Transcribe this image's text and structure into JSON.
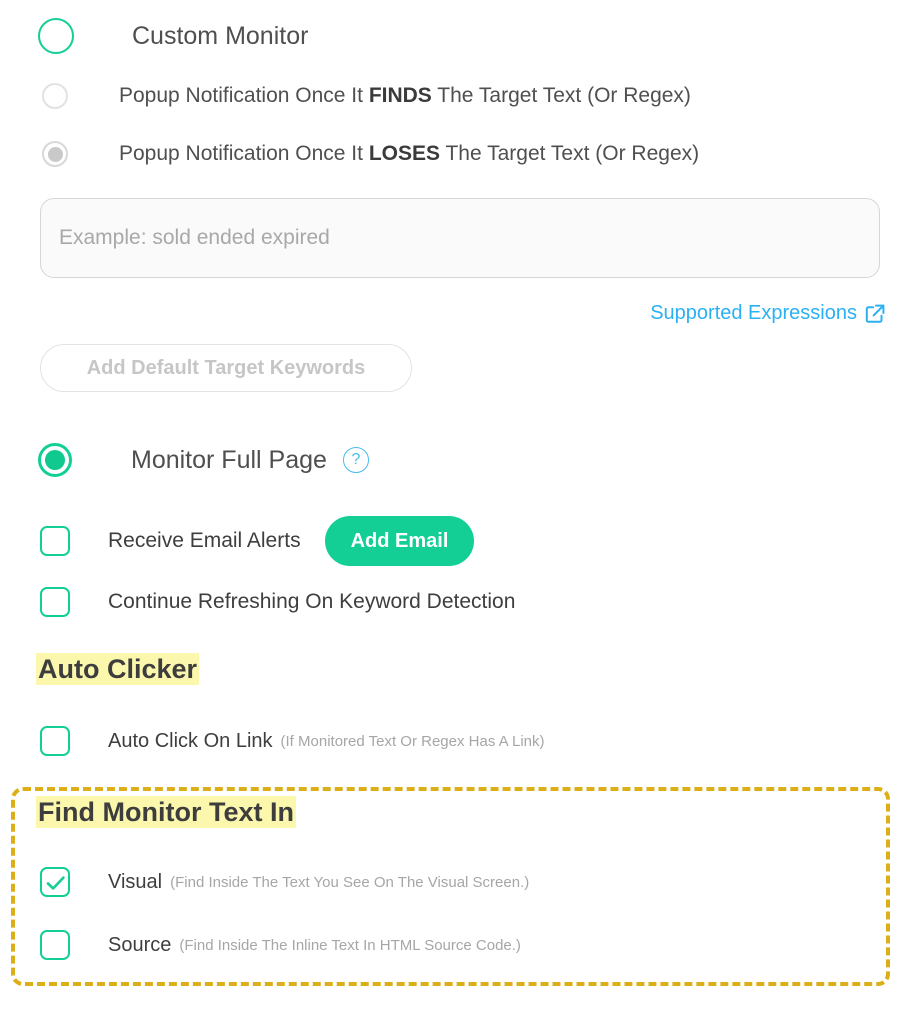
{
  "monitor_options": {
    "custom_monitor": {
      "label": "Custom Monitor",
      "state": "unselected"
    },
    "finds": {
      "prefix": "Popup Notification Once It ",
      "strong": "FINDS",
      "suffix": " The Target Text (Or Regex)",
      "state": "unselected"
    },
    "loses": {
      "prefix": "Popup Notification Once It ",
      "strong": "LOSES",
      "suffix": " The Target Text (Or Regex)",
      "state": "selected-disabled"
    }
  },
  "keywords_input": {
    "value": "",
    "placeholder": "Example: sold ended expired"
  },
  "supported_expressions": {
    "label": "Supported Expressions",
    "icon": "external-link-icon",
    "color": "#2ab1f2"
  },
  "add_default_keywords_button": {
    "label": "Add Default Target Keywords",
    "disabled": true
  },
  "monitor_full_page": {
    "label": "Monitor Full Page",
    "state": "selected",
    "help_icon": "?",
    "accent": "#13cf96"
  },
  "receive_email_alerts": {
    "label": "Receive Email Alerts",
    "checked": false,
    "button_label": "Add Email"
  },
  "continue_refreshing": {
    "label": "Continue Refreshing On Keyword Detection",
    "checked": false
  },
  "auto_clicker": {
    "heading": "Auto Clicker",
    "highlight_color": "#fbf7ad",
    "auto_click_on_link": {
      "label": "Auto Click On Link",
      "hint": "(If Monitored Text Or Regex Has A Link)",
      "checked": false
    }
  },
  "find_monitor_text_in": {
    "heading": "Find Monitor Text In",
    "border_color": "#dcaf19",
    "visual": {
      "label": "Visual",
      "hint": "(Find Inside The Text You See On The Visual Screen.)",
      "checked": true
    },
    "source": {
      "label": "Source",
      "hint": "(Find Inside The Inline Text In HTML Source Code.)",
      "checked": false
    }
  }
}
